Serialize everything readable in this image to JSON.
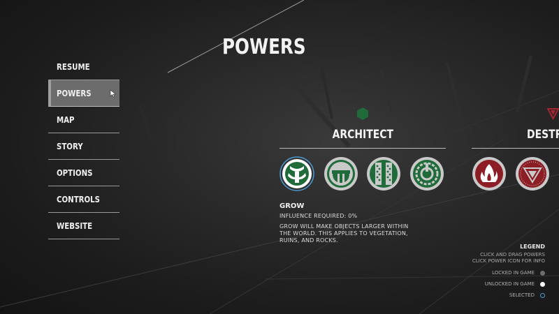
{
  "page_title": "POWERS",
  "menu": {
    "items": [
      {
        "label": "RESUME"
      },
      {
        "label": "POWERS",
        "active": true
      },
      {
        "label": "MAP"
      },
      {
        "label": "STORY"
      },
      {
        "label": "OPTIONS"
      },
      {
        "label": "CONTROLS"
      },
      {
        "label": "WEBSITE"
      }
    ]
  },
  "groups": [
    {
      "title": "ARCHITECT",
      "icon": "hexagon-icon",
      "color": "#1f6b3a",
      "powers": [
        "grow-power-icon",
        "bridge-power-icon",
        "pillar-power-icon",
        "shield-power-icon"
      ]
    },
    {
      "title": "DESTRO",
      "icon": "triangle-icon",
      "color": "#8c1d24",
      "powers": [
        "fire-power-icon",
        "sink-power-icon"
      ]
    }
  ],
  "info": {
    "name": "GROW",
    "influence": "INFLUENCE REQUIRED: 0%",
    "description": "GROW WILL MAKE OBJECTS LARGER WITHIN THE WORLD. THIS APPLIES TO VEGETATION, RUINS, AND ROCKS."
  },
  "legend": {
    "title": "LEGEND",
    "hint1": "CLICK AND DRAG POWERS",
    "hint2": "CLICK POWER ICON FOR INFO",
    "rows": [
      {
        "label": "LOCKED IN GAME",
        "color": "#6e6e6e"
      },
      {
        "label": "UNLOCKED IN GAME",
        "color": "#ffffff"
      },
      {
        "label": "SELECTED",
        "color": "#4a9ad0"
      }
    ]
  }
}
